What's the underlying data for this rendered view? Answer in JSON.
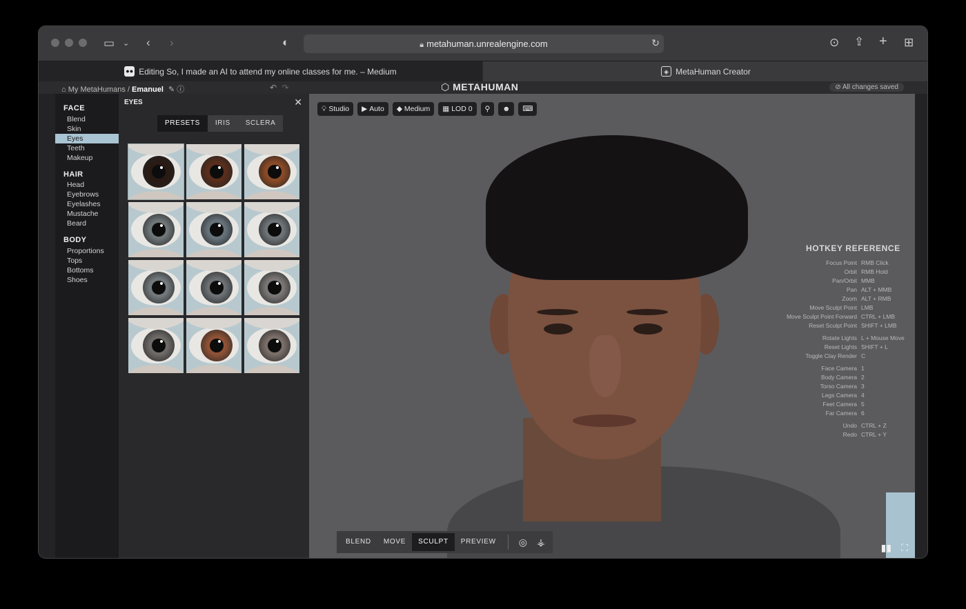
{
  "browser": {
    "url": "metahuman.unrealengine.com",
    "tabs": [
      {
        "title": "Editing So, I made an AI to attend my online classes for me. – Medium",
        "favicon": "medium-icon"
      },
      {
        "title": "MetaHuman Creator",
        "favicon": "metahuman-icon"
      }
    ]
  },
  "app": {
    "breadcrumb_root": "My MetaHumans /",
    "character_name": "Emanuel",
    "logo_text": "METAHUMAN",
    "save_status": "All changes saved"
  },
  "sidebar": {
    "sections": [
      {
        "title": "FACE",
        "items": [
          "Blend",
          "Skin",
          "Eyes",
          "Teeth",
          "Makeup"
        ]
      },
      {
        "title": "HAIR",
        "items": [
          "Head",
          "Eyebrows",
          "Eyelashes",
          "Mustache",
          "Beard"
        ]
      },
      {
        "title": "BODY",
        "items": [
          "Proportions",
          "Tops",
          "Bottoms",
          "Shoes"
        ]
      }
    ],
    "active_item": "Eyes"
  },
  "eyes_panel": {
    "title": "EYES",
    "tabs": [
      "PRESETS",
      "IRIS",
      "SCLERA"
    ],
    "active_tab": "PRESETS",
    "preset_iris_colors": [
      "#2a1a14",
      "#5a2e1c",
      "#8a4a26",
      "#6f7678",
      "#66727a",
      "#6d7377",
      "#72797c",
      "#6c7073",
      "#7a7675",
      "#6e6a67",
      "#8e5236",
      "#7a6e68"
    ]
  },
  "viewport": {
    "toolbar": [
      {
        "icon": "light-icon",
        "label": "Studio"
      },
      {
        "icon": "camera-icon",
        "label": "Auto"
      },
      {
        "icon": "quality-icon",
        "label": "Medium"
      },
      {
        "icon": "lod-icon",
        "label": "LOD 0"
      },
      {
        "icon": "link-icon",
        "label": ""
      },
      {
        "icon": "head-icon",
        "label": ""
      },
      {
        "icon": "keyboard-icon",
        "label": ""
      }
    ],
    "modes": [
      "BLEND",
      "MOVE",
      "SCULPT",
      "PREVIEW"
    ],
    "active_mode": "SCULPT"
  },
  "hotkeys": {
    "title": "HOTKEY REFERENCE",
    "rows": [
      {
        "action": "Focus Point",
        "key": "RMB Click"
      },
      {
        "action": "Orbit",
        "key": "RMB Hold"
      },
      {
        "action": "Pan/Orbit",
        "key": "MMB"
      },
      {
        "action": "Pan",
        "key": "ALT + MMB"
      },
      {
        "action": "Zoom",
        "key": "ALT + RMB"
      },
      {
        "action": "Move Sculpt Point",
        "key": "LMB"
      },
      {
        "action": "Move Sculpt Point Forward",
        "key": "CTRL + LMB"
      },
      {
        "action": "Reset Sculpt Point",
        "key": "SHIFT + LMB"
      },
      {
        "action": "Rotate Lights",
        "key": "L + Mouse Move"
      },
      {
        "action": "Reset Lights",
        "key": "SHIFT + L"
      },
      {
        "action": "Toggle Clay Render",
        "key": "C"
      },
      {
        "action": "Face Camera",
        "key": "1"
      },
      {
        "action": "Body Camera",
        "key": "2"
      },
      {
        "action": "Torso Camera",
        "key": "3"
      },
      {
        "action": "Legs Camera",
        "key": "4"
      },
      {
        "action": "Feet Camera",
        "key": "5"
      },
      {
        "action": "Far Camera",
        "key": "6"
      },
      {
        "action": "Undo",
        "key": "CTRL + Z"
      },
      {
        "action": "Redo",
        "key": "CTRL + Y"
      }
    ]
  }
}
